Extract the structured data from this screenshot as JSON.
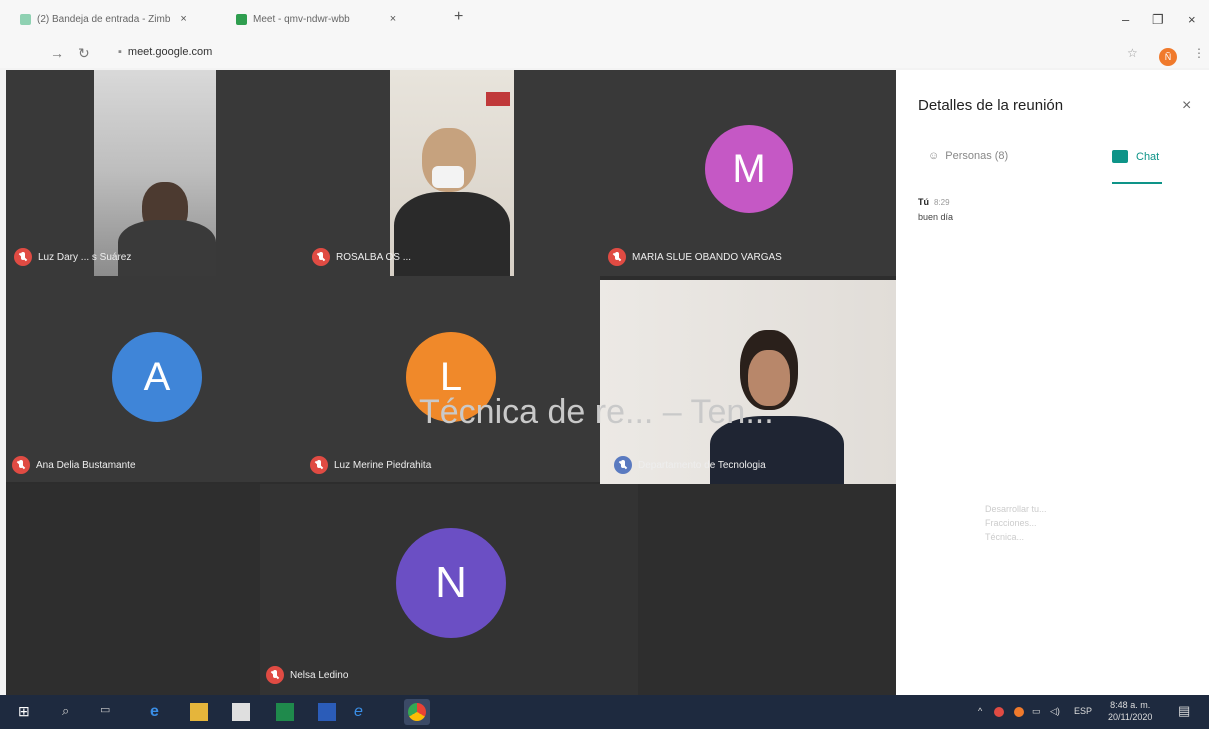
{
  "browser": {
    "tabs": [
      {
        "title": "(2) Bandeja de entrada - Zimb",
        "close": "×"
      },
      {
        "title": "Meet - qmv-ndwr-wbb",
        "close": "×"
      }
    ],
    "new_tab": "+",
    "url": "meet.google.com",
    "window_controls": {
      "minimize": "–",
      "maximize": "❐",
      "close": "×"
    },
    "profile_initial": "Ñ"
  },
  "participants": [
    {
      "name": "Luz Dary ... s Suárez",
      "type": "video"
    },
    {
      "name": "ROSALBA OS ... ",
      "type": "video"
    },
    {
      "name": "MARIA SLUE OBANDO VARGAS",
      "type": "avatar",
      "initial": "M",
      "color": "#c558c5"
    },
    {
      "name": "Ana Delia Bustamante",
      "type": "avatar",
      "initial": "A",
      "color": "#3f85d8"
    },
    {
      "name": "Luz Merine Piedrahita",
      "type": "avatar",
      "initial": "L",
      "color": "#f0892a"
    },
    {
      "name": "Departamento de Tecnologia",
      "type": "video"
    },
    {
      "name": "Nelsa Ledino",
      "type": "avatar",
      "initial": "N",
      "color": "#6b4fc4"
    }
  ],
  "presentation": {
    "title": "Técnica de re... – Ten...",
    "bullets": [
      "Desarrollar tu...",
      "Fracciones...",
      "Técnica..."
    ]
  },
  "side_panel": {
    "title": "Detalles de la reunión",
    "close": "×",
    "tabs": [
      {
        "label": "Personas (8)",
        "icon": "people-icon"
      },
      {
        "label": "Chat",
        "icon": "chat-icon",
        "active": true
      }
    ],
    "messages": [
      {
        "from": "Tú",
        "time": "8:29",
        "text": "buen día"
      }
    ]
  },
  "taskbar": {
    "tray": {
      "lang": "ESP",
      "time": "8:48 a. m.",
      "date": "20/11/2020"
    }
  },
  "colors": {
    "meet_accent": "#0e9488",
    "mic_muted": "#e04b43",
    "taskbar": "#1e2a3f"
  }
}
